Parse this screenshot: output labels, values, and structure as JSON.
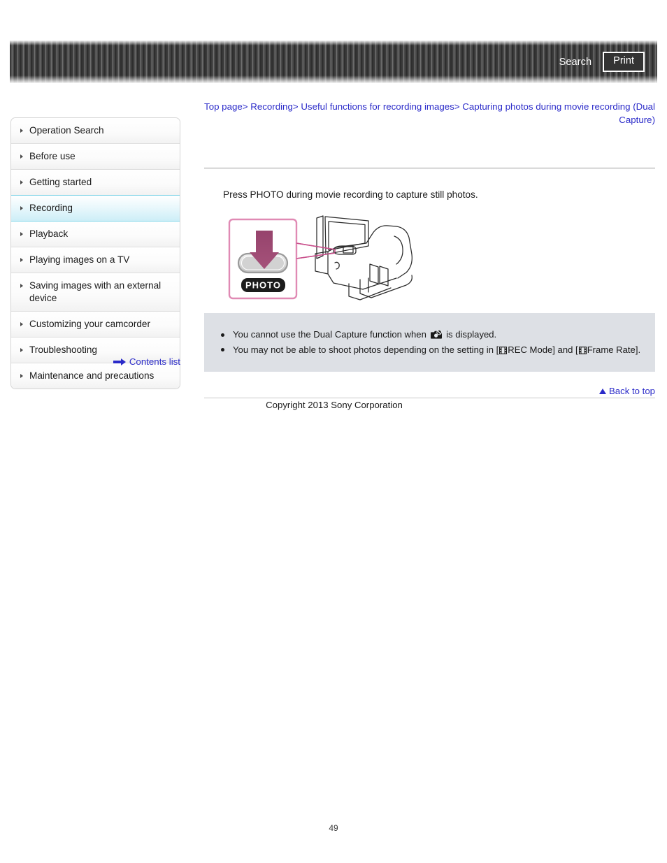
{
  "header": {
    "search_label": "Search",
    "print_label": "Print"
  },
  "breadcrumb": {
    "items": [
      {
        "label": "Top page"
      },
      {
        "label": "Recording"
      },
      {
        "label": "Useful functions for recording images"
      },
      {
        "label": "Capturing photos during movie recording (Dual Capture)"
      }
    ],
    "separator": ">"
  },
  "sidebar": {
    "items": [
      {
        "label": "Operation Search",
        "active": false
      },
      {
        "label": "Before use",
        "active": false
      },
      {
        "label": "Getting started",
        "active": false
      },
      {
        "label": "Recording",
        "active": true
      },
      {
        "label": "Playback",
        "active": false
      },
      {
        "label": "Playing images on a TV",
        "active": false
      },
      {
        "label": "Saving images with an external device",
        "active": false
      },
      {
        "label": "Customizing your camcorder",
        "active": false
      },
      {
        "label": "Troubleshooting",
        "active": false
      },
      {
        "label": "Maintenance and precautions",
        "active": false
      }
    ],
    "contents_link": "Contents list"
  },
  "main": {
    "intro": "Press PHOTO during movie recording to capture still photos.",
    "illustration": {
      "button_label": "PHOTO",
      "callout_color": "#d4639a",
      "arrow_color": "#8e4569"
    }
  },
  "notes": {
    "background": "#dde0e5",
    "items": [
      {
        "parts": [
          {
            "type": "text",
            "value": "You cannot use the Dual Capture function when "
          },
          {
            "type": "icon",
            "value": "no-camera-icon"
          },
          {
            "type": "text",
            "value": " is displayed."
          }
        ]
      },
      {
        "parts": [
          {
            "type": "text",
            "value": "You may not be able to shoot photos depending on the setting in ["
          },
          {
            "type": "icon",
            "value": "film-icon"
          },
          {
            "type": "text",
            "value": "REC Mode] and ["
          },
          {
            "type": "icon",
            "value": "film-icon"
          },
          {
            "type": "text",
            "value": "Frame Rate]."
          }
        ]
      }
    ]
  },
  "footer": {
    "back_to_top": "Back to top",
    "copyright": "Copyright 2013 Sony Corporation",
    "page_number": "49"
  },
  "colors": {
    "link": "#2b2bc9",
    "active_nav": "#cdeef7",
    "active_nav_border": "#7fd4e8",
    "notes_bg": "#dde0e5",
    "header_dark": "#3a3a3a"
  }
}
